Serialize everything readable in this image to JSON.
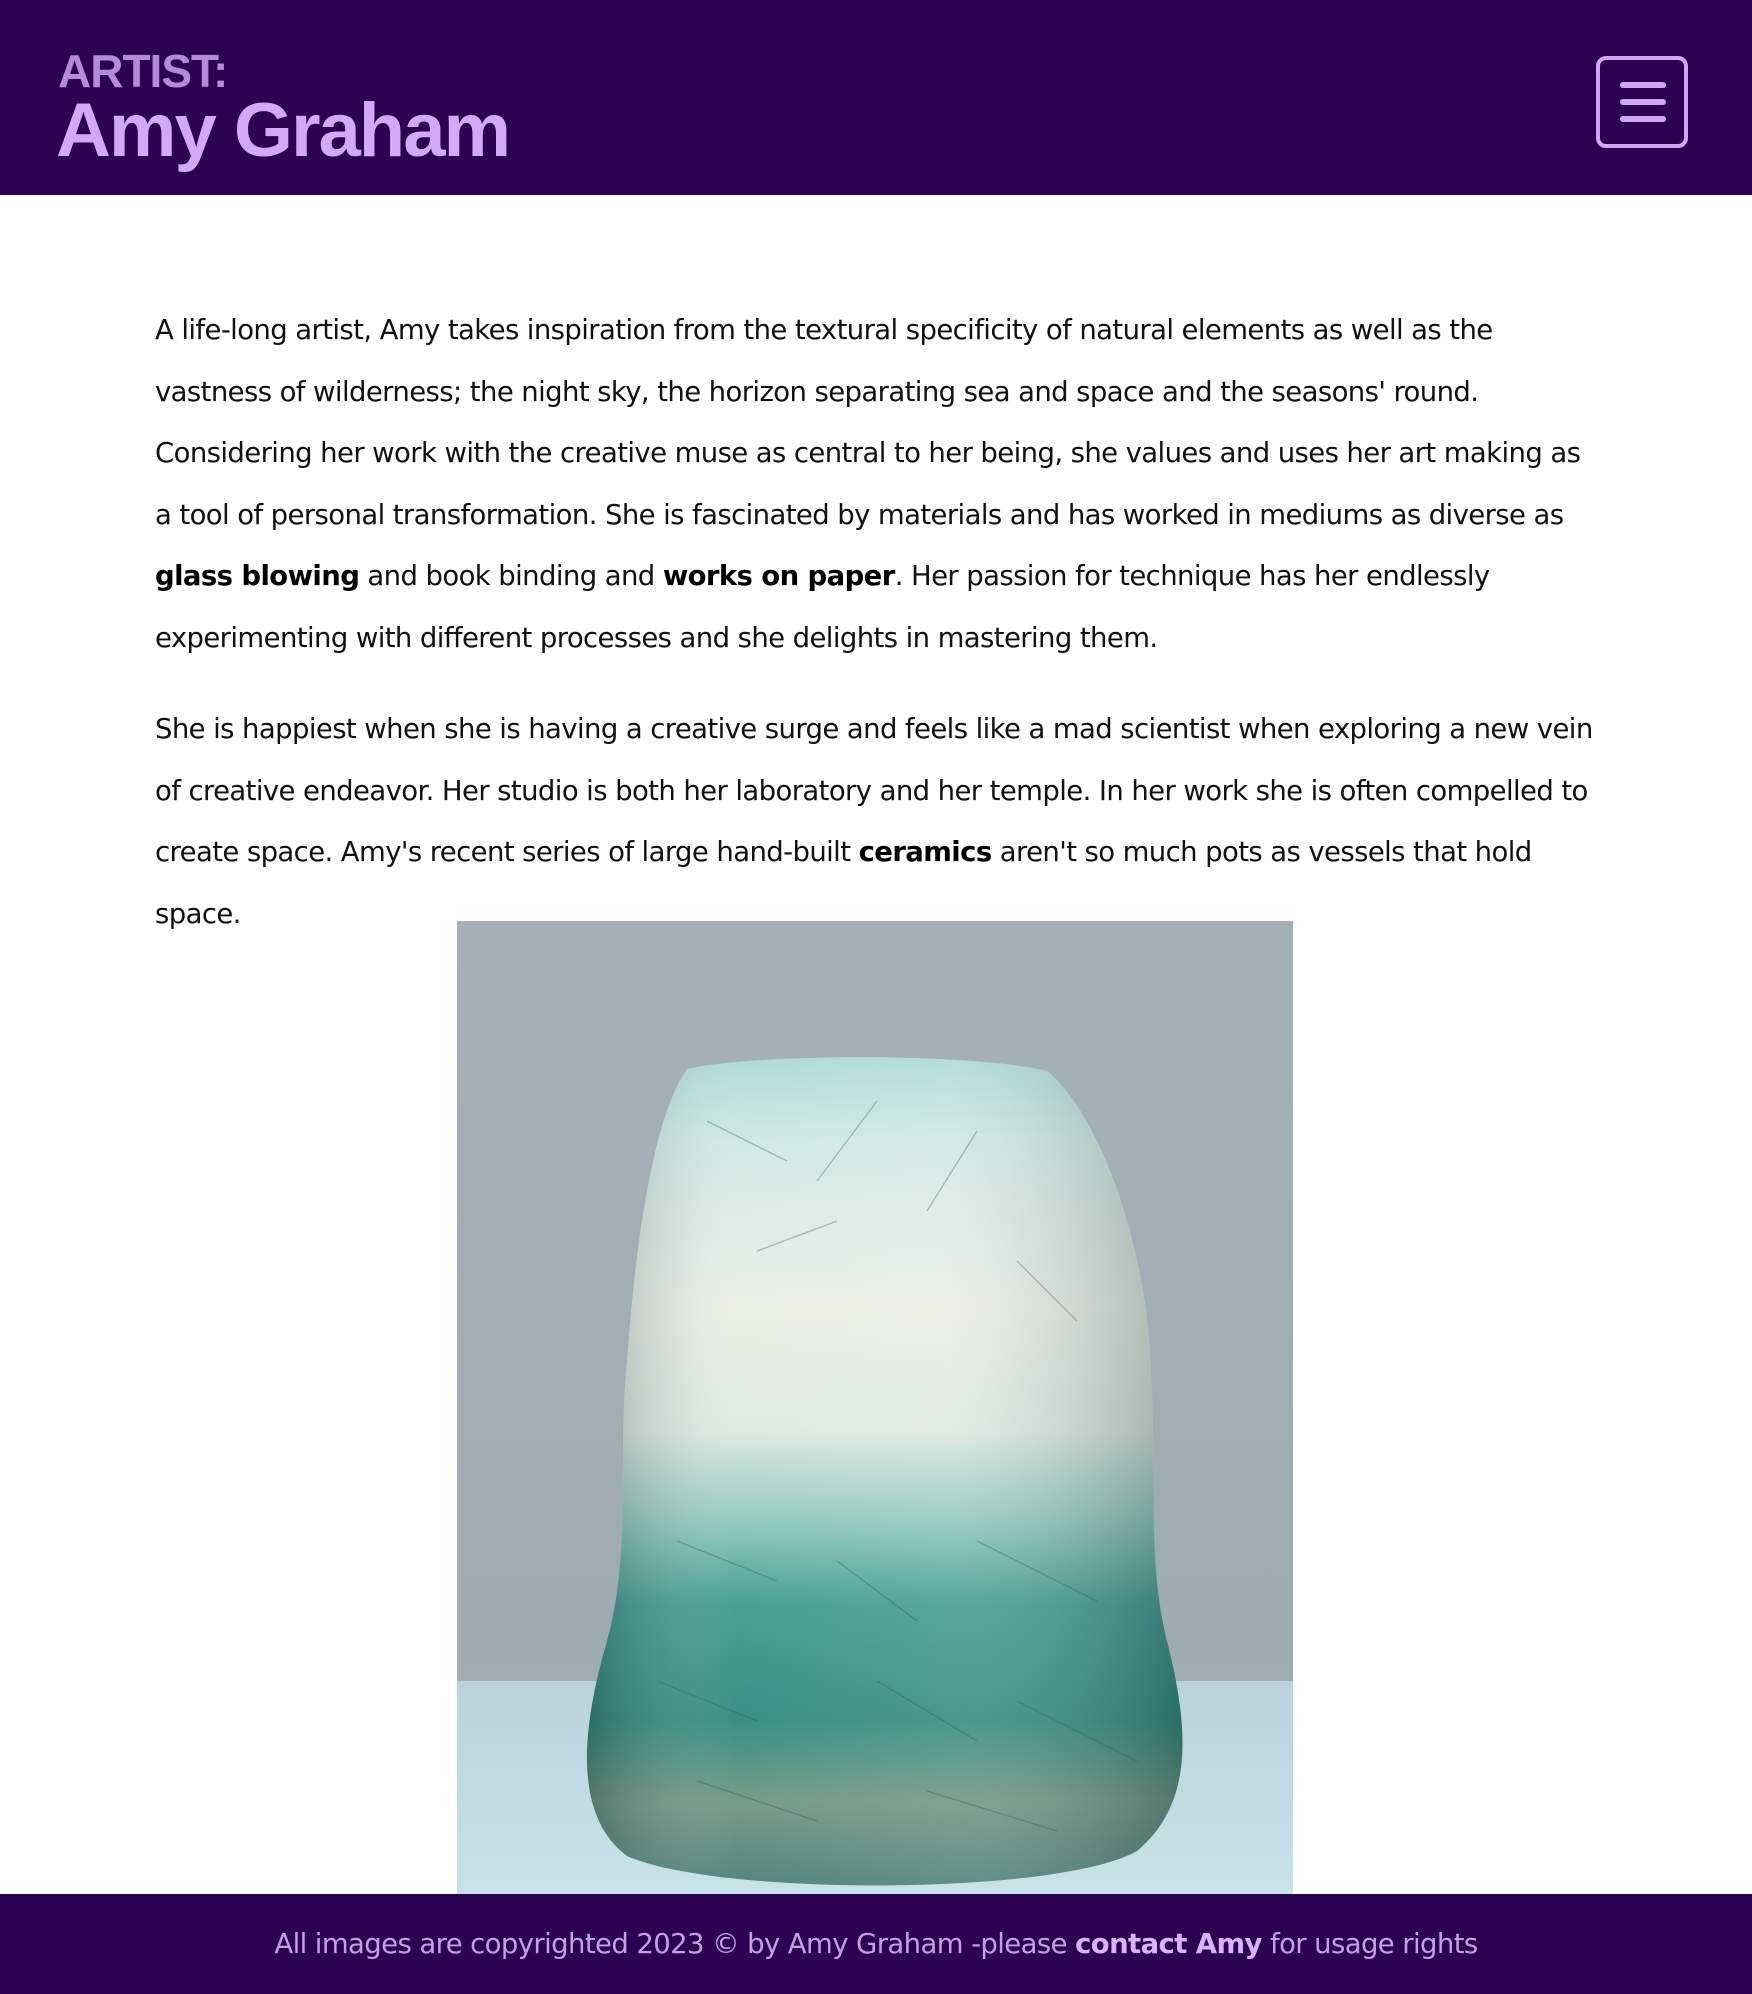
{
  "header": {
    "kicker": "ARTIST:",
    "name": "Amy Graham",
    "menu_icon": "hamburger-menu-icon"
  },
  "main": {
    "paragraph_1": {
      "text_1": "A life-long artist, Amy takes inspiration from the textural specificity of natural elements as well as the vastness of wilderness; the night sky, the horizon separating sea and space and the seasons' round. Considering her work with the creative muse as central to her being, she values and uses her art making as a tool of personal transformation. She is fascinated by materials and has worked in mediums as diverse as ",
      "bold_1": "glass blowing",
      "text_2": " and book binding and ",
      "bold_2": "works on paper",
      "text_3": ". Her passion for technique has her endlessly experimenting with different processes and she delights in mastering them."
    },
    "paragraph_2": {
      "text_1": "She is happiest when she is having a creative surge and feels like a mad scientist when exploring a new vein of creative endeavor. Her studio is both her laboratory and her temple. In her work she is often compelled to create space. Amy's recent series of large hand-built ",
      "bold_1": "ceramics",
      "text_2": " aren't so much pots as vessels that hold space."
    }
  },
  "footer": {
    "text_before": "All images are copyrighted 2023 © by Amy Graham -please ",
    "link": "contact Amy",
    "text_after": " for usage rights"
  },
  "colors": {
    "header_bg": "#2b0050",
    "kicker": "#b58ad9",
    "name": "#d4a8f5",
    "footer_text": "#c4a0e2"
  }
}
